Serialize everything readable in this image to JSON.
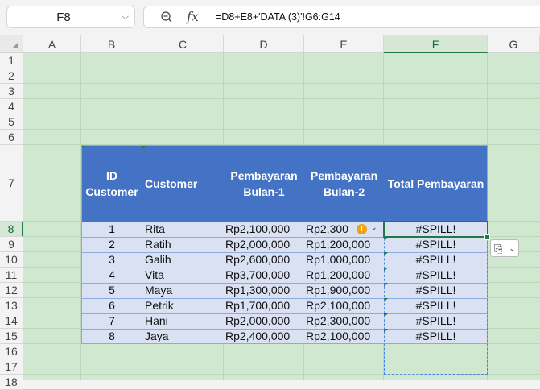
{
  "name_box": {
    "value": "F8",
    "chevron_icon": "chevron-down-icon"
  },
  "formula_bar": {
    "zoom_icon": "🔍",
    "fx_label": "fx",
    "formula": "=D8+E8+'DATA (3)'!G6:G14"
  },
  "columns": [
    "A",
    "B",
    "C",
    "D",
    "E",
    "F",
    "G"
  ],
  "rows": [
    "1",
    "2",
    "3",
    "4",
    "5",
    "6",
    "7",
    "8",
    "9",
    "10",
    "11",
    "12",
    "13",
    "14",
    "15",
    "16",
    "17",
    "18"
  ],
  "active_cell": {
    "column": "F",
    "row": "8"
  },
  "table": {
    "headers": {
      "id": "ID Customer",
      "customer": "Customer",
      "bulan1": "Pembayaran Bulan-1",
      "bulan2": "Pembayaran Bulan-2",
      "total": "Total Pembayaran"
    },
    "header_color": "#4472c4",
    "band_color": "#d9e1f2",
    "rows": [
      {
        "id": "1",
        "customer": "Rita",
        "bulan1": "Rp2,100,000",
        "bulan2": "Rp2,300",
        "total": "#SPILL!"
      },
      {
        "id": "2",
        "customer": "Ratih",
        "bulan1": "Rp2,000,000",
        "bulan2": "Rp1,200,000",
        "total": "#SPILL!"
      },
      {
        "id": "3",
        "customer": "Galih",
        "bulan1": "Rp2,600,000",
        "bulan2": "Rp1,000,000",
        "total": "#SPILL!"
      },
      {
        "id": "4",
        "customer": "Vita",
        "bulan1": "Rp3,700,000",
        "bulan2": "Rp1,200,000",
        "total": "#SPILL!"
      },
      {
        "id": "5",
        "customer": "Maya",
        "bulan1": "Rp1,300,000",
        "bulan2": "Rp1,900,000",
        "total": "#SPILL!"
      },
      {
        "id": "6",
        "customer": "Petrik",
        "bulan1": "Rp1,700,000",
        "bulan2": "Rp2,100,000",
        "total": "#SPILL!"
      },
      {
        "id": "7",
        "customer": "Hani",
        "bulan1": "Rp2,000,000",
        "bulan2": "Rp2,300,000",
        "total": "#SPILL!"
      },
      {
        "id": "8",
        "customer": "Jaya",
        "bulan1": "Rp2,400,000",
        "bulan2": "Rp2,100,000",
        "total": "#SPILL!"
      }
    ]
  },
  "warning": {
    "icon": "!",
    "chevron": "⌄"
  },
  "paste_options": {
    "icon": "paste-options-icon",
    "glyph": "⎘",
    "chevron": "⌄"
  },
  "colors": {
    "sheet_green": "#cfe8cf",
    "active_green": "#1f7a43",
    "spill_border": "#4a86e8"
  }
}
